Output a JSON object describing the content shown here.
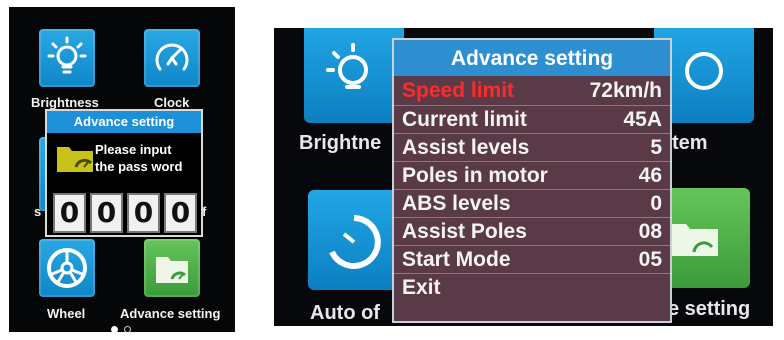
{
  "left_screen": {
    "tiles": {
      "brightness": {
        "label": "Brightness",
        "icon": "lightbulb-icon"
      },
      "clock": {
        "label": "Clock",
        "icon": "clock-icon"
      },
      "wheel": {
        "label": "Wheel",
        "icon": "wheel-icon"
      },
      "advance_setting": {
        "label": "Advance setting",
        "icon": "folder-gauge-icon"
      }
    },
    "partial_left_letter": "s",
    "partial_right_letter": "f",
    "password_dialog": {
      "title": "Advance setting",
      "message_line1": "Please input",
      "message_line2": "the pass word",
      "digits": [
        "0",
        "0",
        "0",
        "0"
      ]
    },
    "pager": {
      "pages": 2,
      "current": 1
    }
  },
  "right_screen": {
    "background_labels": {
      "left_top": "Brightne",
      "right_top": "tem",
      "left_bottom": "Auto of",
      "right_bottom": "e setting"
    },
    "menu": {
      "title": "Advance setting",
      "items": [
        {
          "label": "Speed limit",
          "value": "72km/h",
          "selected": true
        },
        {
          "label": "Current limit",
          "value": "45A"
        },
        {
          "label": "Assist levels",
          "value": "5"
        },
        {
          "label": "Poles in motor",
          "value": "46"
        },
        {
          "label": "ABS levels",
          "value": "0"
        },
        {
          "label": "Assist Poles",
          "value": "08"
        },
        {
          "label": "Start Mode",
          "value": "05"
        },
        {
          "label": "Exit",
          "value": ""
        }
      ]
    }
  },
  "colors": {
    "tile_blue": "#1a97d8",
    "tile_green": "#4cae46",
    "dialog_title_blue": "#1e90d8",
    "menu_background": "#5b3a48",
    "selected_text": "#ff2b2b"
  }
}
